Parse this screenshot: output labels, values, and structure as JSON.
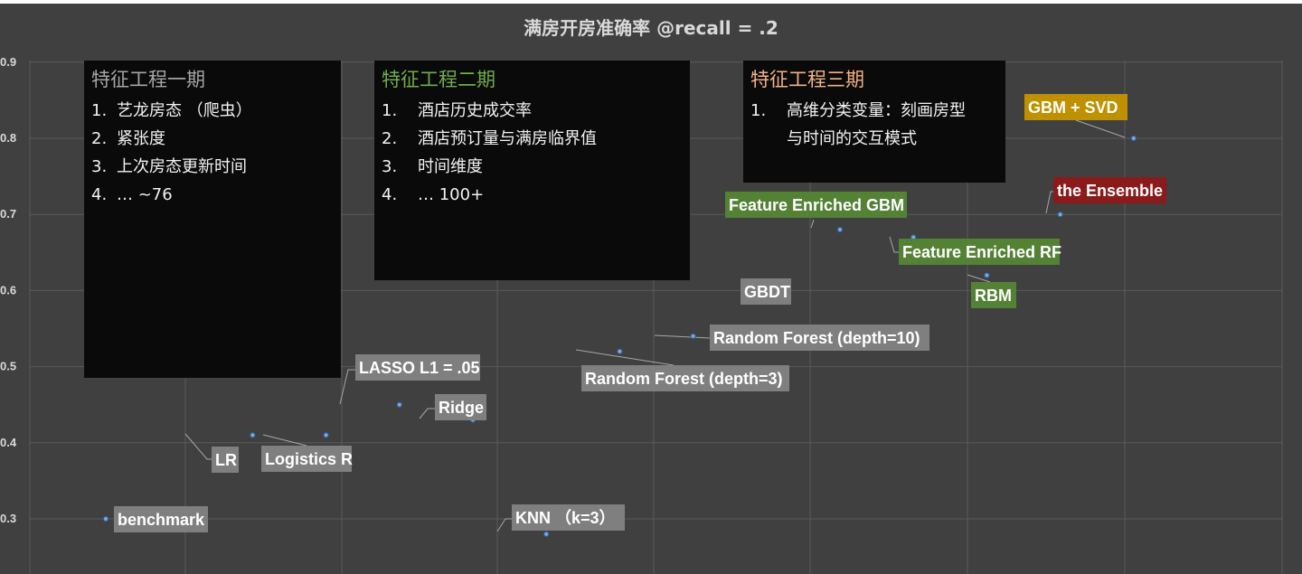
{
  "chart_data": {
    "type": "scatter",
    "title": "满房开房准确率 @recall = .2",
    "xlabel": "",
    "ylabel": "",
    "ylim": [
      0.28,
      0.9
    ],
    "yticks": [
      "0.3",
      "0.4",
      "0.5",
      "0.6",
      "0.7",
      "0.8",
      "0.9"
    ],
    "grid": true,
    "points": [
      {
        "label": "benchmark",
        "x": 1,
        "y": 0.3
      },
      {
        "label": "LR",
        "x": 2,
        "y": 0.41
      },
      {
        "label": "Logistics R",
        "x": 2.5,
        "y": 0.41
      },
      {
        "label": "LASSO L1 = .05",
        "x": 3,
        "y": 0.45
      },
      {
        "label": "Ridge",
        "x": 3.5,
        "y": 0.43
      },
      {
        "label": "KNN （k=3）",
        "x": 4,
        "y": 0.28
      },
      {
        "label": "Random Forest (depth=3)",
        "x": 4.5,
        "y": 0.52
      },
      {
        "label": "Random Forest (depth=10)",
        "x": 5,
        "y": 0.54
      },
      {
        "label": "GBDT",
        "x": 5.5,
        "y": 0.6
      },
      {
        "label": "Feature Enriched GBM",
        "x": 6,
        "y": 0.68
      },
      {
        "label": "Feature Enriched RF",
        "x": 6.5,
        "y": 0.67
      },
      {
        "label": "RBM",
        "x": 7,
        "y": 0.62
      },
      {
        "label": "the Ensemble",
        "x": 7.5,
        "y": 0.7
      },
      {
        "label": "GBM + SVD",
        "x": 8,
        "y": 0.8
      }
    ],
    "label_colors": {
      "gray": "#7f7f7f",
      "green": "#548235",
      "red": "#8b1a1a",
      "gold": "#bf9000"
    }
  },
  "phases": [
    {
      "title": "特征工程一期",
      "title_color": "#a6a6a6",
      "items": [
        {
          "num": "1.",
          "text": "艺龙房态 （爬虫）"
        },
        {
          "num": "2.",
          "text": "紧张度"
        },
        {
          "num": "3.",
          "text": "上次房态更新时间"
        },
        {
          "num": "4.",
          "text": "… ~76"
        }
      ]
    },
    {
      "title": "特征工程二期",
      "title_color": "#70ad47",
      "items": [
        {
          "num": "1.",
          "text": "酒店历史成交率"
        },
        {
          "num": "2.",
          "text": "酒店预订量与满房临界值"
        },
        {
          "num": "3.",
          "text": "时间维度"
        },
        {
          "num": "4.",
          "text": "… 100+"
        }
      ]
    },
    {
      "title": "特征工程三期",
      "title_color": "#f4b183",
      "items": [
        {
          "num": "1.",
          "text": "高维分类变量：刻画房型"
        },
        {
          "num": "",
          "text": "与时间的交互模式"
        }
      ]
    }
  ]
}
